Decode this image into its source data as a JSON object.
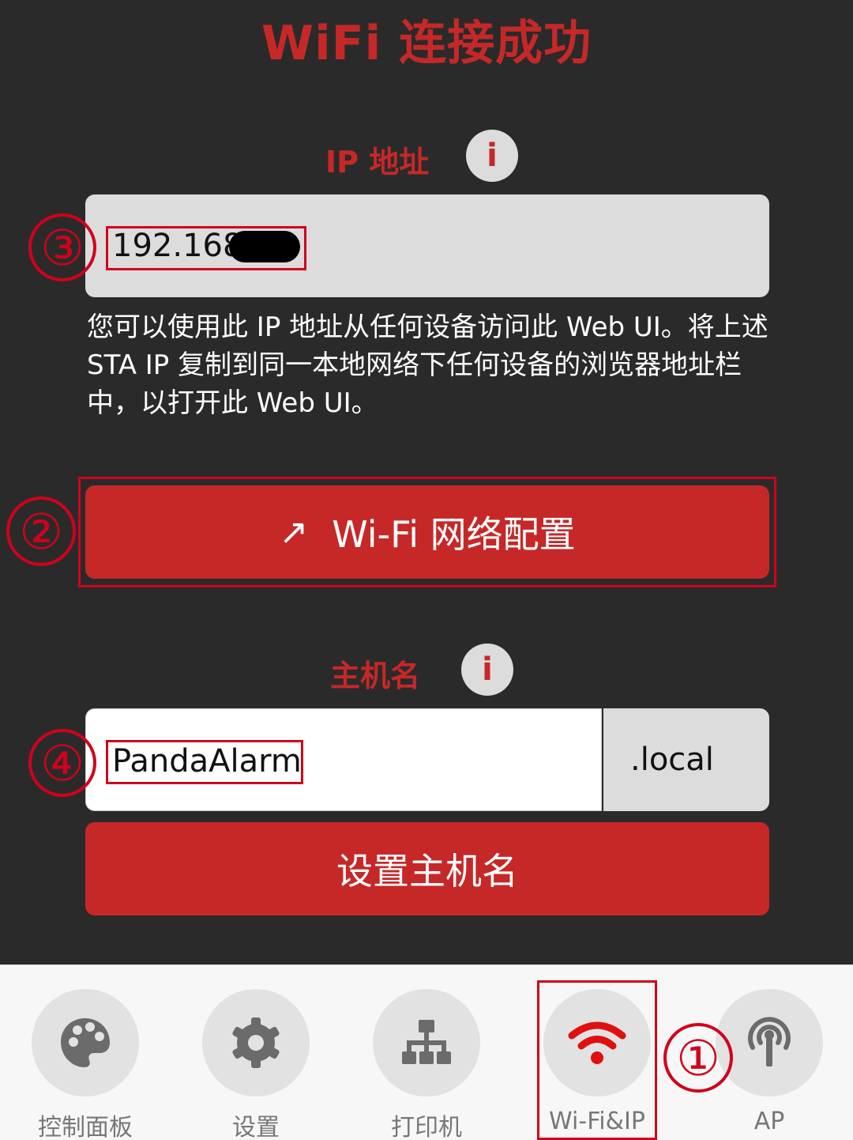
{
  "page": {
    "title": "WiFi 连接成功"
  },
  "ip_section": {
    "label": "IP 地址",
    "info": "i",
    "value": "192.168.",
    "description": "您可以使用此 IP 地址从任何设备访问此 Web UI。将上述 STA IP 复制到同一本地网络下任何设备的浏览器地址栏中，以打开此 Web UI。"
  },
  "wifi_config_button": {
    "arrow": "↗",
    "label": "Wi-Fi 网络配置"
  },
  "hostname_section": {
    "label": "主机名",
    "info": "i",
    "value": "PandaAlarm",
    "suffix": ".local",
    "set_button": "设置主机名"
  },
  "annotations": {
    "n1": "①",
    "n2": "②",
    "n3": "③",
    "n4": "④"
  },
  "tabbar": {
    "items": [
      {
        "label": "控制面板",
        "icon": "palette-icon"
      },
      {
        "label": "设置",
        "icon": "gear-icon"
      },
      {
        "label": "打印机",
        "icon": "network-tree-icon"
      },
      {
        "label": "Wi-Fi&IP",
        "icon": "wifi-icon",
        "active": true
      },
      {
        "label": "AP",
        "icon": "broadcast-antenna-icon"
      }
    ]
  },
  "colors": {
    "accent": "#c62828",
    "background": "#2b2a2a",
    "annotation": "#d0021b"
  }
}
